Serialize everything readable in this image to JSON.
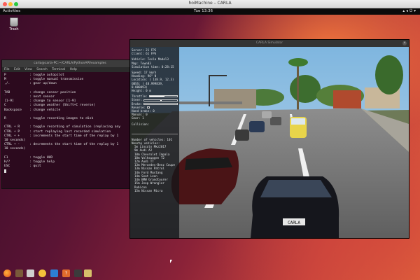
{
  "mac": {
    "title": "hoiMachine – CARLA"
  },
  "topbar": {
    "activities": "Activities",
    "clock": "Tue 13:36"
  },
  "desktop": {
    "trash_label": "Trash"
  },
  "terminal": {
    "title": "carla@carla-PC:~/CARLA/PythonAPI/examples",
    "menu": [
      "File",
      "Edit",
      "View",
      "Search",
      "Terminal",
      "Help"
    ],
    "lines": [
      {
        "key": "P",
        "desc": ": toggle autopilot"
      },
      {
        "key": "M",
        "desc": ": toggle manual transmission"
      },
      {
        "key": ",/.",
        "desc": ": gear up/down"
      },
      {
        "key": "",
        "desc": ""
      },
      {
        "key": "TAB",
        "desc": ": change sensor position"
      },
      {
        "key": "`",
        "desc": ": next sensor"
      },
      {
        "key": "[1-9]",
        "desc": ": change to sensor [1-9]"
      },
      {
        "key": "C",
        "desc": ": change weather (Shift+C reverse)"
      },
      {
        "key": "Backspace",
        "desc": ": change vehicle"
      },
      {
        "key": "",
        "desc": ""
      },
      {
        "key": "R",
        "desc": ": toggle recording images to disk"
      },
      {
        "key": "",
        "desc": ""
      },
      {
        "key": "CTRL + R",
        "desc": ": toggle recording of simulation (replacing any"
      },
      {
        "key": "CTRL + P",
        "desc": ": start replaying last recorded simulation"
      },
      {
        "key": "CTRL + +",
        "desc": ": increments the start time of the replay by 1"
      },
      {
        "key": "10 seconds)",
        "desc": ""
      },
      {
        "key": "CTRL + -",
        "desc": ": decrements the start time of the replay by 1"
      },
      {
        "key": "10 seconds)",
        "desc": ""
      },
      {
        "key": "",
        "desc": ""
      },
      {
        "key": "F1",
        "desc": ": toggle HUD"
      },
      {
        "key": "H/?",
        "desc": ": toggle help"
      },
      {
        "key": "ESC",
        "desc": ": quit"
      }
    ]
  },
  "carla": {
    "title": "CARLA Simulator",
    "hud": {
      "server": "Server:  21 FPS",
      "client": "Client:  61 FPS",
      "vehicle": "Vehicle:    Tesla Model3",
      "map": "Map:           Town03",
      "sim_time": "Simulation time:  0:28:15",
      "speed": "Speed:       17 km/h",
      "heading": "Heading:      96° N",
      "location": "Location:  ( 138.9,  12.3)",
      "gnss": "GNSS: ( 48.999839,  8.000093)",
      "height": "Height:       0 m",
      "throttle_label": "Throttle:",
      "throttle_value": 0.55,
      "steer_label": "Steer:",
      "brake_label": "Brake:",
      "brake_value": 0,
      "reverse_label": "Reverse:",
      "handbrake": "Hand brake:    0",
      "manual": "Manual:        0",
      "gear": "Gear:          1",
      "collision": "Collision:",
      "num_vehicles": "Number of vehicles:   101",
      "nearby_title": "Nearby vehicles:",
      "nearby": [
        "5m Lincoln Mkz2017",
        "9m Audi A2",
        "10m Chevrolet Impala",
        "10m Volkswagen T2",
        "12m Audi TT",
        "13m Mercedes-Benz Coupe",
        "13m Nissan Patrol",
        "14m Ford Mustang",
        "14m Seat Leon",
        "14m BMW Grandtourer",
        "15m Jeep Wrangler Rubicon",
        "15m Nissan Micra"
      ],
      "plate": "CARLA"
    }
  },
  "dock": {
    "icons": [
      "firefox-icon",
      "files-icon",
      "files-icon",
      "rhythmbox-icon",
      "writer-icon",
      "help-icon",
      "amazon-icon",
      "terminal-icon"
    ]
  }
}
